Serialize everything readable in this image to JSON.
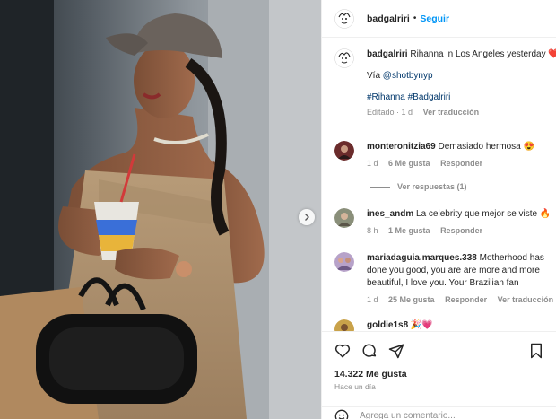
{
  "post": {
    "username": "badgalriri",
    "separator": "•",
    "follow_label": "Seguir",
    "next_icon": "chevron-right-icon"
  },
  "caption": {
    "username": "badgalriri",
    "text": "Rihanna in Los Angeles yesterday",
    "emoji": "❤️",
    "via": "Vía",
    "mention": "@shotbynyp",
    "hashtags": "#Rihanna #Badgalriri",
    "edited": "Editado · 1 d",
    "translate": "Ver traducción"
  },
  "comments": [
    {
      "username": "monteronitzia69",
      "text": "Demasiado hermosa",
      "emoji": "😍",
      "age": "1 d",
      "likes": "6 Me gusta",
      "reply": "Responder"
    },
    {
      "username": "ines_andm",
      "text": "La celebrity que mejor se viste",
      "emoji": "🔥",
      "age": "8 h",
      "likes": "1 Me gusta",
      "reply": "Responder"
    },
    {
      "username": "mariadaguia.marques.338",
      "text": "Motherhood has done you good, you are are more and more beautiful, I love you. Your Brazilian fan",
      "age": "1 d",
      "likes": "25 Me gusta",
      "reply": "Responder",
      "translate": "Ver traducción"
    },
    {
      "username": "goldie1s8",
      "emoji": "🎉💗"
    }
  ],
  "replies_label": "Ver respuestas (1)",
  "actions": {
    "likes": "14.322 Me gusta",
    "time": "Hace un día"
  },
  "add_comment": {
    "placeholder": "Agrega un comentario..."
  },
  "colors": {
    "link_blue": "#0095f6",
    "muted": "#8e8e8e",
    "text": "#262626",
    "divider": "#efefef"
  }
}
